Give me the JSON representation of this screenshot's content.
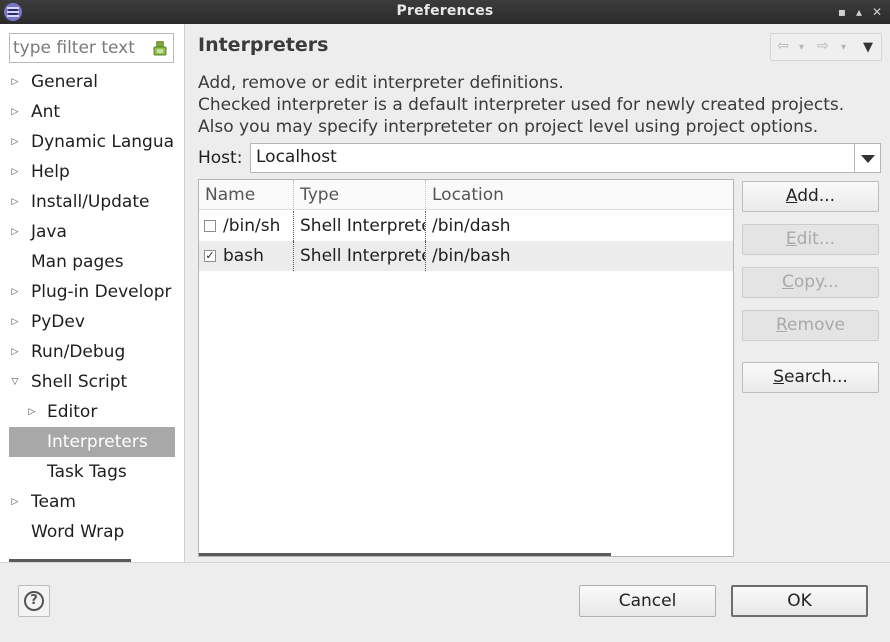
{
  "window": {
    "title": "Preferences",
    "controls": {
      "minimize": "▪",
      "maximize": "▴",
      "close": "✕"
    }
  },
  "filter": {
    "placeholder": "type filter text"
  },
  "tree": [
    {
      "label": "General",
      "expandable": true
    },
    {
      "label": "Ant",
      "expandable": true
    },
    {
      "label": "Dynamic Langua",
      "expandable": true
    },
    {
      "label": "Help",
      "expandable": true
    },
    {
      "label": "Install/Update",
      "expandable": true
    },
    {
      "label": "Java",
      "expandable": true
    },
    {
      "label": "Man pages",
      "expandable": false
    },
    {
      "label": "Plug-in Developr",
      "expandable": true
    },
    {
      "label": "PyDev",
      "expandable": true
    },
    {
      "label": "Run/Debug",
      "expandable": true
    },
    {
      "label": "Shell Script",
      "expandable": true,
      "expanded": true
    },
    {
      "label": "Editor",
      "expandable": true,
      "level": 1
    },
    {
      "label": "Interpreters",
      "expandable": false,
      "level": 1,
      "selected": true
    },
    {
      "label": "Task Tags",
      "expandable": false,
      "level": 1
    },
    {
      "label": "Team",
      "expandable": true
    },
    {
      "label": "Word Wrap",
      "expandable": false
    }
  ],
  "page": {
    "title": "Interpreters",
    "description": [
      "Add, remove or edit interpreter definitions.",
      "Checked interpreter is a default interpreter used for newly created projects.",
      "Also you may specify interpreteter on project level using project options."
    ],
    "host_label": "Host:",
    "host_value": "Localhost"
  },
  "table": {
    "columns": [
      "Name",
      "Type",
      "Location"
    ],
    "rows": [
      {
        "checked": false,
        "name": "/bin/sh",
        "type": "Shell Interpreter",
        "location": "/bin/dash"
      },
      {
        "checked": true,
        "name": "bash",
        "type": "Shell Interpreter",
        "location": "/bin/bash"
      }
    ]
  },
  "buttons": {
    "add": {
      "mnemonic": "A",
      "rest": "dd..."
    },
    "edit": {
      "mnemonic": "E",
      "rest": "dit..."
    },
    "copy": {
      "mnemonic": "C",
      "rest": "opy..."
    },
    "remove": {
      "mnemonic": "R",
      "rest": "emove"
    },
    "search": {
      "mnemonic": "S",
      "rest": "earch..."
    },
    "cancel": "Cancel",
    "ok": "OK"
  },
  "icons": {
    "help": "?",
    "check": "✓",
    "back": "⇦",
    "forward": "⇨",
    "menu": "▾"
  }
}
